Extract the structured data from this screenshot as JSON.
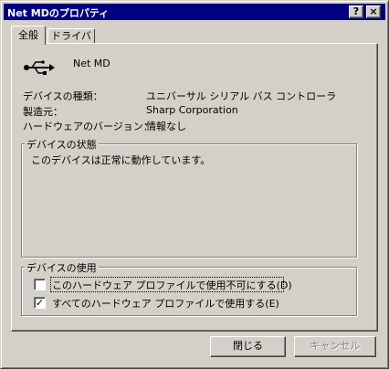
{
  "window": {
    "title": "Net MDのプロパティ",
    "help_button": "?",
    "close_button": "×"
  },
  "tabs": [
    {
      "label": "全般",
      "active": true
    },
    {
      "label": "ドライバ",
      "active": false
    }
  ],
  "device": {
    "name": "Net MD",
    "icon": "usb-icon"
  },
  "properties": [
    {
      "label": "デバイスの種類：",
      "value": "ユニバーサル シリアル バス コントローラ"
    },
    {
      "label": "製造元：",
      "value": "Sharp Corporation"
    },
    {
      "label": "ハードウェアのバージョン：",
      "value": "情報なし"
    }
  ],
  "status_group": {
    "legend": "デバイスの状態",
    "text": "このデバイスは正常に動作しています。"
  },
  "usage_group": {
    "legend": "デバイスの使用",
    "options": [
      {
        "label": "このハードウェア プロファイルで使用不可にする(D)",
        "checked": false,
        "focused": true
      },
      {
        "label": "すべてのハードウェア プロファイルで使用する(E)",
        "checked": true,
        "focused": false
      }
    ]
  },
  "buttons": {
    "close": "閉じる",
    "cancel": "キャンセル"
  }
}
